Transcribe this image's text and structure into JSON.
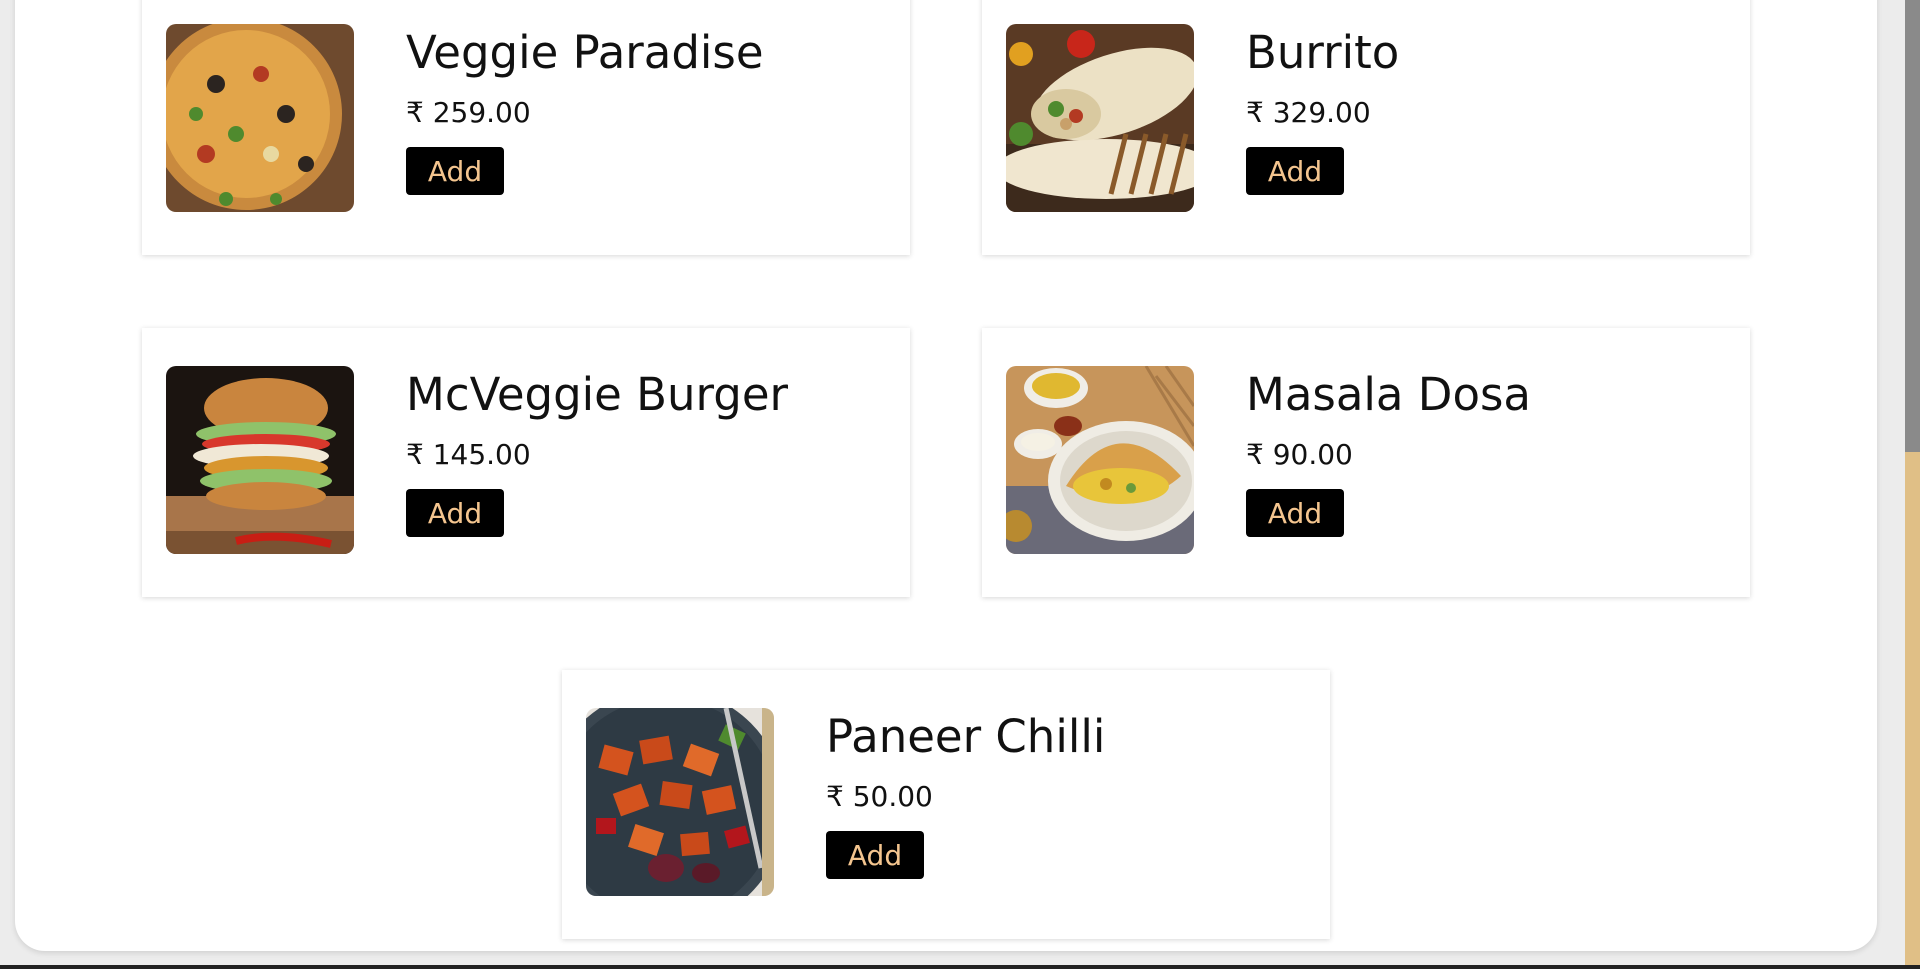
{
  "menu": {
    "items": [
      {
        "name": "Veggie Paradise",
        "price": "₹ 259.00",
        "button": "Add"
      },
      {
        "name": "Burrito",
        "price": "₹ 329.00",
        "button": "Add"
      },
      {
        "name": "McVeggie Burger",
        "price": "₹ 145.00",
        "button": "Add"
      },
      {
        "name": "Masala Dosa",
        "price": "₹ 90.00",
        "button": "Add"
      },
      {
        "name": "Paneer Chilli",
        "price": "₹ 50.00",
        "button": "Add"
      }
    ]
  },
  "colors": {
    "button_bg": "#000000",
    "button_text": "#f4c58f",
    "scroll_track": "#e0bf86"
  }
}
